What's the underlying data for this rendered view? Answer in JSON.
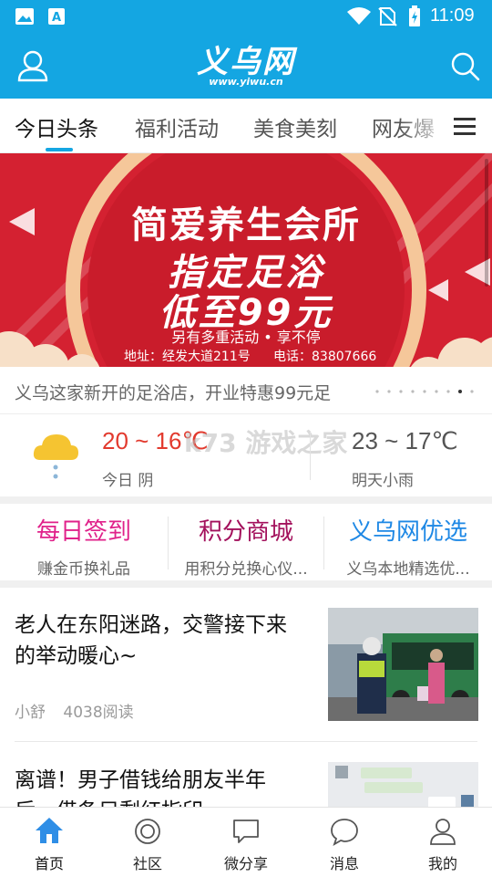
{
  "status_bar": {
    "time": "11:09"
  },
  "header": {
    "logo_text": "义乌网",
    "logo_url": "www.yiwu.cn"
  },
  "tabs": [
    {
      "label": "今日头条",
      "active": true
    },
    {
      "label": "福利活动"
    },
    {
      "label": "美食美刻"
    },
    {
      "label": "网友爆"
    }
  ],
  "banner": {
    "line1": "简爱养生会所",
    "line2": "指定足浴",
    "line3": "低至99元",
    "promo": "另有多重活动 • 享不停",
    "address": "地址：经发大道211号",
    "phone": "电话：83807666",
    "caption": "义乌这家新开的足浴店，开业特惠99元足"
  },
  "weather": {
    "today_range": "20 ~ 16℃",
    "today_label": "今日 阴",
    "tomorrow_range": "23 ~ 17℃",
    "tomorrow_label": "明天小雨",
    "watermark": "k73 游戏之家",
    "watermark_url": ".com"
  },
  "quick_links": [
    {
      "title": "每日签到",
      "subtitle": "赚金币换礼品",
      "color": "#e0218a"
    },
    {
      "title": "积分商城",
      "subtitle": "用积分兑换心仪...",
      "color": "#a3115c"
    },
    {
      "title": "义乌网优选",
      "subtitle": "义乌本地精选优...",
      "color": "#1e88e5"
    }
  ],
  "news": [
    {
      "title": "老人在东阳迷路，交警接下来的举动暖心~",
      "author": "小舒",
      "reads": "4038阅读"
    },
    {
      "title": "离谱！男子借钱给朋友半年后，借条只剩红指印",
      "author": "",
      "reads": ""
    }
  ],
  "bottom_nav": [
    {
      "label": "首页",
      "active": true
    },
    {
      "label": "社区"
    },
    {
      "label": "微分享"
    },
    {
      "label": "消息"
    },
    {
      "label": "我的"
    }
  ],
  "colors": {
    "brand": "#14a6e2",
    "banner_red": "#d42131"
  }
}
